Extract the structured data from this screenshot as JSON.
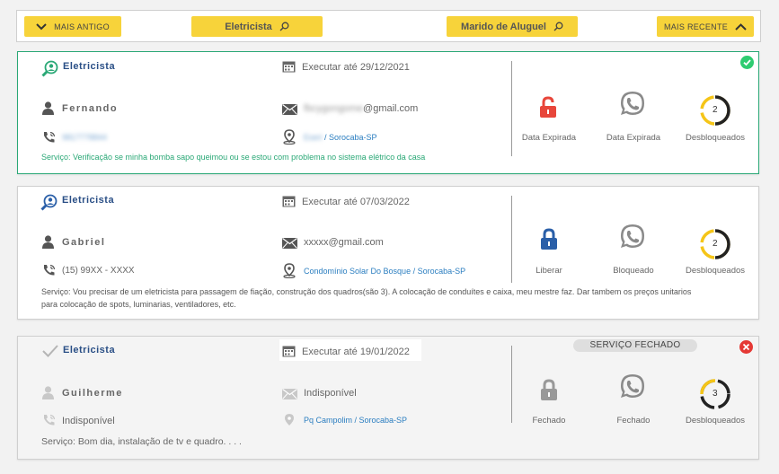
{
  "filters": {
    "older_label": "MAIS ANTIGO",
    "category1": "Eletricista",
    "category2": "Marido de Aluguel",
    "newer_label": "MAIS RECENTE"
  },
  "cards": [
    {
      "category": "Eletricista",
      "date": "Executar até 29/12/2021",
      "name": "Fernando",
      "email_hidden": "fbcygongome",
      "email_domain": "@gmail.com",
      "phone_hidden": "9817778844",
      "location_hidden": "Eseri",
      "location_city": " / Sorocaba-SP",
      "description": "Serviço: Verificação se minha bomba sapo queimou ou se estou com problema no sistema elétrico da casa",
      "action1": "Data Expirada",
      "action2": "Data Expirada",
      "action3": "Desbloqueados",
      "unlocked_count": "2",
      "status_colors": {
        "border": "#2aa876",
        "lock": "#e8463b"
      }
    },
    {
      "category": "Eletricista",
      "date": "Executar até 07/03/2022",
      "name": "Gabriel",
      "email": "xxxxx@gmail.com",
      "phone": "(15) 99XX - XXXX",
      "location": "Condomínio Solar Do Bosque / Sorocaba-SP",
      "description_line1": "Serviço: Vou precisar de um eletricista para passagem de fiação, construção dos quadros(são 3). A colocação de conduítes e caixa, meu mestre faz. Dar tambem os preços unitarios",
      "description_line2": "para colocação de spots, luminarias, ventiladores, etc.",
      "action1": "Liberar",
      "action2": "Bloqueado",
      "action3": "Desbloqueados",
      "unlocked_count": "2",
      "status_colors": {
        "lock": "#2a5fa8"
      }
    },
    {
      "category": "Eletricista",
      "date": "Executar até 19/01/2022",
      "badge": "SERVIÇO FECHADO",
      "name": "Guilherme",
      "email": "Indisponível",
      "phone": "Indisponível",
      "location": "Pq Campolim / Sorocaba-SP",
      "description": "Serviço: Bom dia, instalação de tv e quadro. . . .",
      "action1": "Fechado",
      "action2": "Fechado",
      "action3": "Desbloqueados",
      "unlocked_count": "3",
      "status_colors": {
        "lock": "#999999",
        "close": "#e53935"
      }
    }
  ],
  "colors": {
    "accent_yellow": "#f7d33a",
    "success_green": "#2aa876",
    "link_blue": "#2b7ec0"
  }
}
